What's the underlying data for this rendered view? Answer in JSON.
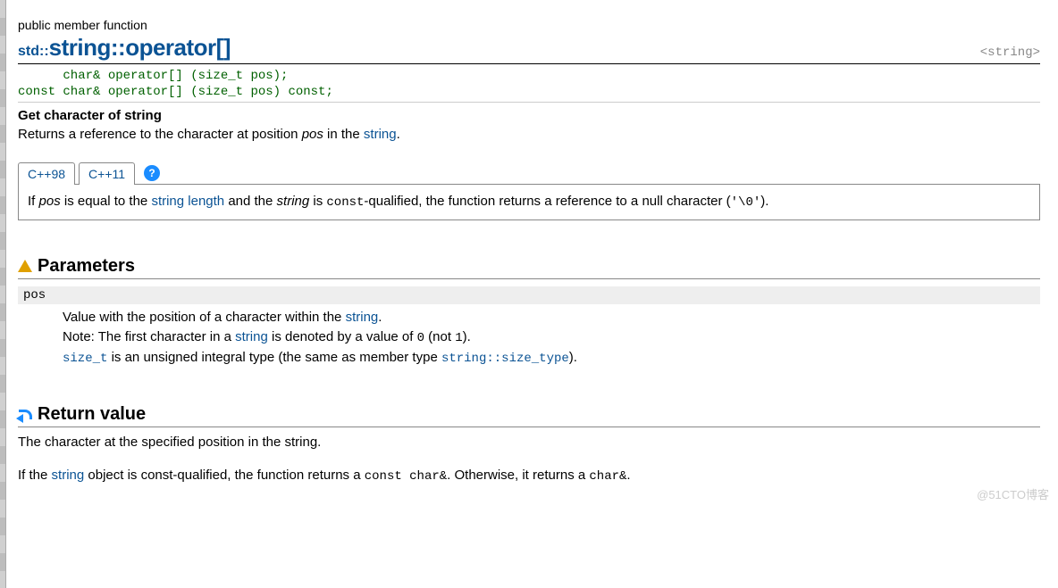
{
  "category": "public member function",
  "namespace": "std::",
  "name": "string::operator[]",
  "header_include": "<string>",
  "prototype": "      char& operator[] (size_t pos);\nconst char& operator[] (size_t pos) const;",
  "short_desc": "Get character of string",
  "desc_pre": "Returns a reference to the character at position ",
  "desc_em": "pos",
  "desc_mid": " in the ",
  "desc_link": "string",
  "desc_post": ".",
  "tabs": [
    "C++98",
    "C++11"
  ],
  "help_icon": "?",
  "tab_content": {
    "pre": "If ",
    "em1": "pos",
    "mid1": " is equal to the ",
    "link1": "string length",
    "mid2": " and the ",
    "em2": "string",
    "mid3": " is ",
    "code1": "const",
    "mid4": "-qualified, the function returns a reference to a null character (",
    "code2": "'\\0'",
    "post": ")."
  },
  "sections": {
    "parameters": {
      "title": "Parameters",
      "items": [
        {
          "name": "pos",
          "line1_pre": "Value with the position of a character within the ",
          "line1_link": "string",
          "line1_post": ".",
          "line2_pre": "Note: The first character in a ",
          "line2_link": "string",
          "line2_mid": " is denoted by a value of ",
          "line2_code1": "0",
          "line2_mid2": " (not ",
          "line2_code2": "1",
          "line2_post": ").",
          "line3_code": "size_t",
          "line3_mid": " is an unsigned integral type (the same as member type ",
          "line3_link": "string::size_type",
          "line3_post": ")."
        }
      ]
    },
    "return": {
      "title": "Return value",
      "p1": "The character at the specified position in the string.",
      "p2_pre": "If the ",
      "p2_link": "string",
      "p2_mid": " object is const-qualified, the function returns a ",
      "p2_code1": "const char&",
      "p2_mid2": ". Otherwise, it returns a ",
      "p2_code2": "char&",
      "p2_post": "."
    }
  },
  "watermark": "@51CTO博客"
}
